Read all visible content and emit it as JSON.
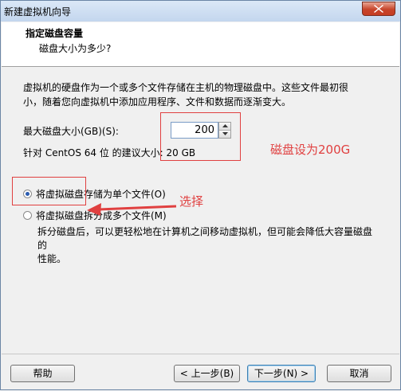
{
  "window": {
    "title": "新建虚拟机向导",
    "close_icon": "close-icon"
  },
  "header": {
    "title": "指定磁盘容量",
    "subtitle": "磁盘大小为多少?"
  },
  "description": {
    "line1": "虚拟机的硬盘作为一个或多个文件存储在主机的物理磁盘中。这些文件最初很",
    "line2": "小，随着您向虚拟机中添加应用程序、文件和数据而逐渐变大。"
  },
  "disk": {
    "size_label": "最大磁盘大小(GB)(S):",
    "size_value": "200",
    "recommend_text": "针对 CentOS 64 位 的建议大小: 20 GB"
  },
  "options": {
    "single_file_label": "将虚拟磁盘存储为单个文件(O)",
    "single_file_checked": true,
    "multi_file_label": "将虚拟磁盘拆分成多个文件(M)",
    "multi_file_checked": false,
    "multi_desc_line1": "拆分磁盘后，可以更轻松地在计算机之间移动虚拟机，但可能会降低大容量磁盘的",
    "multi_desc_line2": "性能。"
  },
  "annotations": {
    "disk_note": "磁盘设为200G",
    "select_note": "选择",
    "color": "#e04040"
  },
  "buttons": {
    "help": "帮助",
    "back": "< 上一步(B)",
    "next": "下一步(N) >",
    "cancel": "取消"
  }
}
